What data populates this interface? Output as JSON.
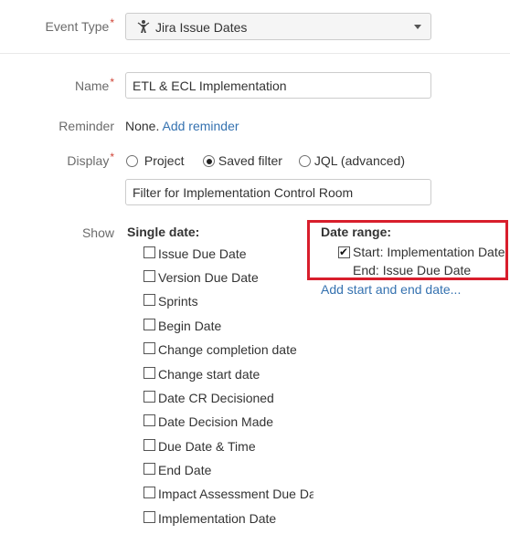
{
  "form": {
    "event_type": {
      "label": "Event Type",
      "required": "*",
      "value": "Jira Issue Dates",
      "icon": "event-type-icon"
    },
    "name": {
      "label": "Name",
      "required": "*",
      "value": "ETL & ECL Implementation"
    },
    "reminder": {
      "label": "Reminder",
      "none_text": "None.",
      "add_link": "Add reminder"
    },
    "display": {
      "label": "Display",
      "required": "*",
      "options": [
        "Project",
        "Saved filter",
        "JQL (advanced)"
      ],
      "selected": "Saved filter",
      "filter_value": "Filter for Implementation Control Room"
    },
    "show": {
      "label": "Show",
      "single_date": {
        "title": "Single date:",
        "items": [
          "Issue Due Date",
          "Version Due Date",
          "Sprints",
          "Begin Date",
          "Change completion date",
          "Change start date",
          "Date CR Decisioned",
          "Date Decision Made",
          "Due Date & Time",
          "End Date",
          "Impact Assessment Due Date",
          "Implementation Date"
        ]
      },
      "date_range": {
        "title": "Date range:",
        "start": "Start: Implementation Date",
        "end": "End: Issue Due Date",
        "add_link": "Add start and end date..."
      }
    }
  },
  "colors": {
    "required": "#d04437",
    "link": "#3572b0",
    "highlight": "#d81e2c"
  }
}
